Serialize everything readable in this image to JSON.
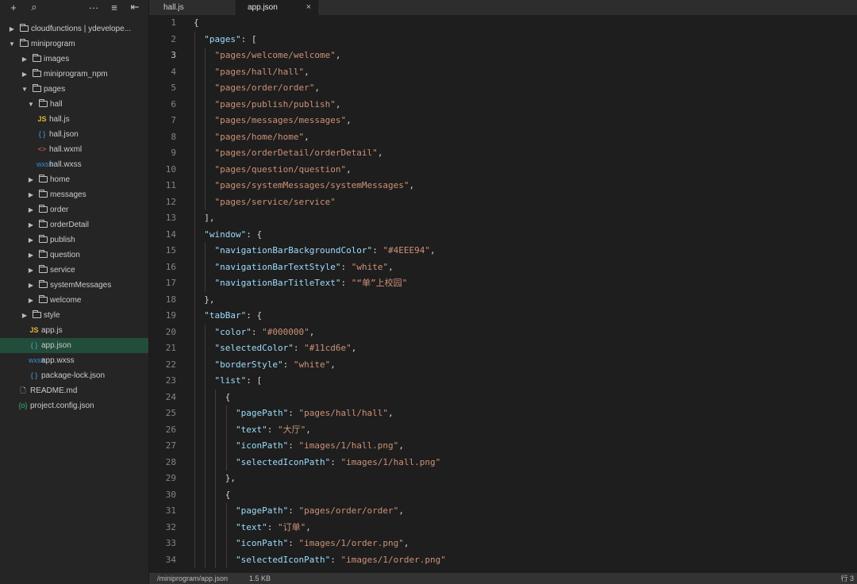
{
  "toolbar": {
    "new_icon": "+",
    "search_icon": "⌕",
    "more_icon": "···",
    "collapse_icon": "≡",
    "split_icon": "⇤"
  },
  "tree": [
    {
      "label": "cloudfunctions | ydevelope...",
      "level": 0,
      "type": "cloudfolder",
      "arrow": "right",
      "icon": "cloud-folder-icon"
    },
    {
      "label": "miniprogram",
      "level": 0,
      "type": "folder",
      "arrow": "down",
      "icon": "folder-open-icon"
    },
    {
      "label": "images",
      "level": 1,
      "type": "folder",
      "arrow": "right",
      "icon": "folder-icon"
    },
    {
      "label": "miniprogram_npm",
      "level": 1,
      "type": "folder",
      "arrow": "right",
      "icon": "folder-icon"
    },
    {
      "label": "pages",
      "level": 1,
      "type": "folder",
      "arrow": "down",
      "icon": "folder-open-icon"
    },
    {
      "label": "hall",
      "level": 2,
      "type": "folder",
      "arrow": "down",
      "icon": "folder-open-icon"
    },
    {
      "label": "hall.js",
      "level": 3,
      "type": "js",
      "icon": "js-file-icon"
    },
    {
      "label": "hall.json",
      "level": 3,
      "type": "json",
      "icon": "json-file-icon"
    },
    {
      "label": "hall.wxml",
      "level": 3,
      "type": "wxml",
      "icon": "wxml-file-icon"
    },
    {
      "label": "hall.wxss",
      "level": 3,
      "type": "wxss",
      "icon": "wxss-file-icon"
    },
    {
      "label": "home",
      "level": 2,
      "type": "folder",
      "arrow": "right",
      "icon": "folder-icon"
    },
    {
      "label": "messages",
      "level": 2,
      "type": "folder",
      "arrow": "right",
      "icon": "folder-icon"
    },
    {
      "label": "order",
      "level": 2,
      "type": "folder",
      "arrow": "right",
      "icon": "folder-icon"
    },
    {
      "label": "orderDetail",
      "level": 2,
      "type": "folder",
      "arrow": "right",
      "icon": "folder-icon"
    },
    {
      "label": "publish",
      "level": 2,
      "type": "folder",
      "arrow": "right",
      "icon": "folder-icon"
    },
    {
      "label": "question",
      "level": 2,
      "type": "folder",
      "arrow": "right",
      "icon": "folder-icon"
    },
    {
      "label": "service",
      "level": 2,
      "type": "folder",
      "arrow": "right",
      "icon": "folder-icon"
    },
    {
      "label": "systemMessages",
      "level": 2,
      "type": "folder",
      "arrow": "right",
      "icon": "folder-icon"
    },
    {
      "label": "welcome",
      "level": 2,
      "type": "folder",
      "arrow": "right",
      "icon": "folder-icon"
    },
    {
      "label": "style",
      "level": 1,
      "type": "folder",
      "arrow": "right",
      "icon": "folder-icon"
    },
    {
      "label": "app.js",
      "level": 1,
      "type": "js",
      "icon": "js-file-icon"
    },
    {
      "label": "app.json",
      "level": 1,
      "type": "json",
      "icon": "json-file-icon",
      "selected": true
    },
    {
      "label": "app.wxss",
      "level": 1,
      "type": "wxss",
      "icon": "wxss-file-icon"
    },
    {
      "label": "package-lock.json",
      "level": 1,
      "type": "json",
      "icon": "json-file-icon"
    },
    {
      "label": "README.md",
      "level": 0,
      "type": "doc",
      "icon": "document-icon"
    },
    {
      "label": "project.config.json",
      "level": 0,
      "type": "cfg",
      "icon": "config-file-icon"
    }
  ],
  "tabs": [
    {
      "label": "hall.js",
      "active": false
    },
    {
      "label": "app.json",
      "active": true,
      "close": "×"
    }
  ],
  "editor": {
    "current_line": 3,
    "lines": [
      "{",
      "  \"pages\": [",
      "    \"pages/welcome/welcome\",",
      "    \"pages/hall/hall\",",
      "    \"pages/order/order\",",
      "    \"pages/publish/publish\",",
      "    \"pages/messages/messages\",",
      "    \"pages/home/home\",",
      "    \"pages/orderDetail/orderDetail\",",
      "    \"pages/question/question\",",
      "    \"pages/systemMessages/systemMessages\",",
      "    \"pages/service/service\"",
      "  ],",
      "  \"window\": {",
      "    \"navigationBarBackgroundColor\": \"#4EEE94\",",
      "    \"navigationBarTextStyle\": \"white\",",
      "    \"navigationBarTitleText\": \"“单”上校园\"",
      "  },",
      "  \"tabBar\": {",
      "    \"color\": \"#000000\",",
      "    \"selectedColor\": \"#11cd6e\",",
      "    \"borderStyle\": \"white\",",
      "    \"list\": [",
      "      {",
      "        \"pagePath\": \"pages/hall/hall\",",
      "        \"text\": \"大厅\",",
      "        \"iconPath\": \"images/1/hall.png\",",
      "        \"selectedIconPath\": \"images/1/hall.png\"",
      "      },",
      "      {",
      "        \"pagePath\": \"pages/order/order\",",
      "        \"text\": \"订单\",",
      "        \"iconPath\": \"images/1/order.png\",",
      "        \"selectedIconPath\": \"images/1/order.png\""
    ]
  },
  "status": {
    "path": "/miniprogram/app.json",
    "size": "1.5 KB",
    "position": "行 3"
  },
  "colors": {
    "key": "#9cdcfe",
    "string": "#ce9178",
    "punctuation": "#d4d4d4",
    "selected_row": "#214d3a"
  }
}
